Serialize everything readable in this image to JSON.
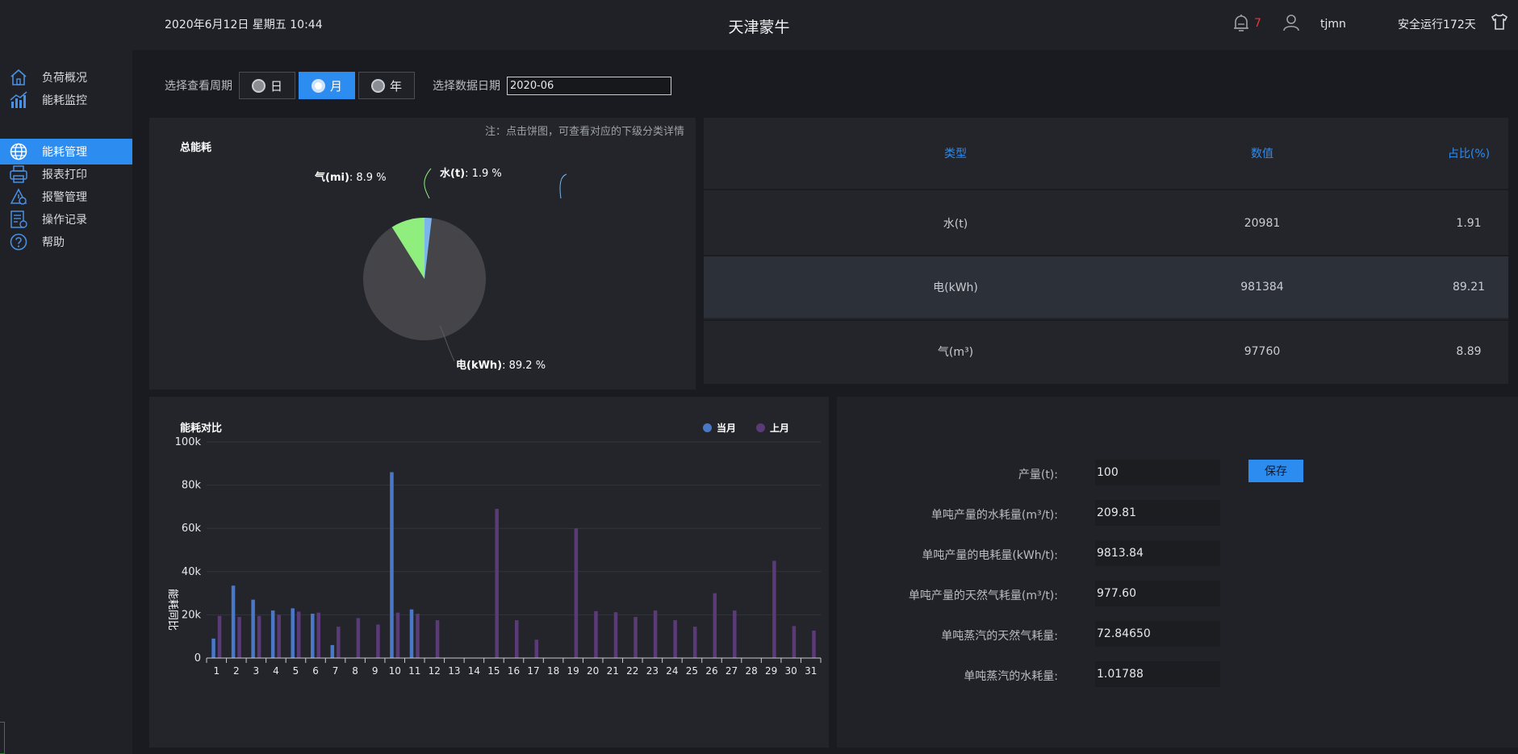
{
  "header": {
    "datetime": "2020年6月12日 星期五 10:44",
    "title": "天津蒙牛",
    "alarm_count": "7",
    "username": "tjmn",
    "safe_run": "安全运行172天"
  },
  "sidebar": {
    "items": [
      {
        "label": "负荷概况",
        "icon": "home-icon"
      },
      {
        "label": "能耗监控",
        "icon": "bar-chart-icon"
      },
      {
        "label": "能耗管理",
        "icon": "globe-icon",
        "active": true
      },
      {
        "label": "报表打印",
        "icon": "printer-icon"
      },
      {
        "label": "报警管理",
        "icon": "alarm-icon"
      },
      {
        "label": "操作记录",
        "icon": "log-icon"
      },
      {
        "label": "帮助",
        "icon": "help-icon"
      }
    ]
  },
  "filter": {
    "period_label": "选择查看周期",
    "options": [
      "日",
      "月",
      "年"
    ],
    "selected": "月",
    "date_label": "选择数据日期",
    "date_value": "2020-06"
  },
  "pie": {
    "title": "总能耗",
    "note": "注：点击饼图，可查看对应的下级分类详情",
    "labels": {
      "water": {
        "name": "水(t)",
        "pct": ": 1.9 %"
      },
      "gas": {
        "name": "气(mi)",
        "pct": ": 8.9 %"
      },
      "elec": {
        "name": "电(kWh)",
        "pct": ": 89.2 %"
      }
    }
  },
  "table": {
    "headers": [
      "类型",
      "数值",
      "占比(%)"
    ],
    "rows": [
      [
        "水(t)",
        "20981",
        "1.91"
      ],
      [
        "电(kWh)",
        "981384",
        "89.21"
      ],
      [
        "气(m³)",
        "97760",
        "8.89"
      ]
    ]
  },
  "bar": {
    "title": "能耗对比",
    "legend": [
      "当月",
      "上月"
    ]
  },
  "stats": {
    "save_label": "保存",
    "rows": [
      {
        "label": "产量(t):",
        "value": "100"
      },
      {
        "label": "单吨产量的水耗量(m³/t):",
        "value": "209.81"
      },
      {
        "label": "单吨产量的电耗量(kWh/t):",
        "value": "9813.84"
      },
      {
        "label": "单吨产量的天然气耗量(m³/t):",
        "value": "977.60"
      },
      {
        "label": "单吨蒸汽的天然气耗量:",
        "value": "72.84650"
      },
      {
        "label": "单吨蒸汽的水耗量:",
        "value": "1.01788"
      }
    ]
  },
  "colors": {
    "accent": "#2d8cf0",
    "current": "#4a78c8",
    "previous": "#5b3a78",
    "pie_elec": "#444449",
    "pie_gas": "#90ee7e",
    "pie_water": "#7cb5ec"
  },
  "chart_data": [
    {
      "type": "pie",
      "title": "总能耗",
      "categories": [
        "电(kWh)",
        "气(mi)",
        "水(t)"
      ],
      "values": [
        89.2,
        8.9,
        1.9
      ]
    },
    {
      "type": "bar",
      "title": "能耗对比",
      "ylabel": "能耗同比",
      "ylim": [
        0,
        100000
      ],
      "yticks": [
        "0",
        "20k",
        "40k",
        "60k",
        "80k",
        "100k"
      ],
      "categories": [
        "1",
        "2",
        "3",
        "4",
        "5",
        "6",
        "7",
        "8",
        "9",
        "10",
        "11",
        "12",
        "13",
        "14",
        "15",
        "16",
        "17",
        "18",
        "19",
        "20",
        "21",
        "22",
        "23",
        "24",
        "25",
        "26",
        "27",
        "28",
        "29",
        "30",
        "31"
      ],
      "series": [
        {
          "name": "当月",
          "values": [
            9000,
            33500,
            27000,
            22000,
            23000,
            20500,
            6000,
            0,
            0,
            86000,
            22500,
            0,
            0,
            0,
            0,
            0,
            0,
            0,
            0,
            0,
            0,
            0,
            0,
            0,
            0,
            0,
            0,
            0,
            0,
            0,
            0
          ]
        },
        {
          "name": "上月",
          "values": [
            19500,
            19000,
            19500,
            20000,
            21500,
            21000,
            14500,
            18500,
            15500,
            21000,
            20500,
            17500,
            0,
            0,
            69000,
            17500,
            8500,
            0,
            60000,
            21700,
            21200,
            19000,
            22000,
            17500,
            14500,
            30000,
            22000,
            0,
            45000,
            14800,
            12700
          ]
        }
      ],
      "legend": "top-right",
      "grid": true
    }
  ]
}
